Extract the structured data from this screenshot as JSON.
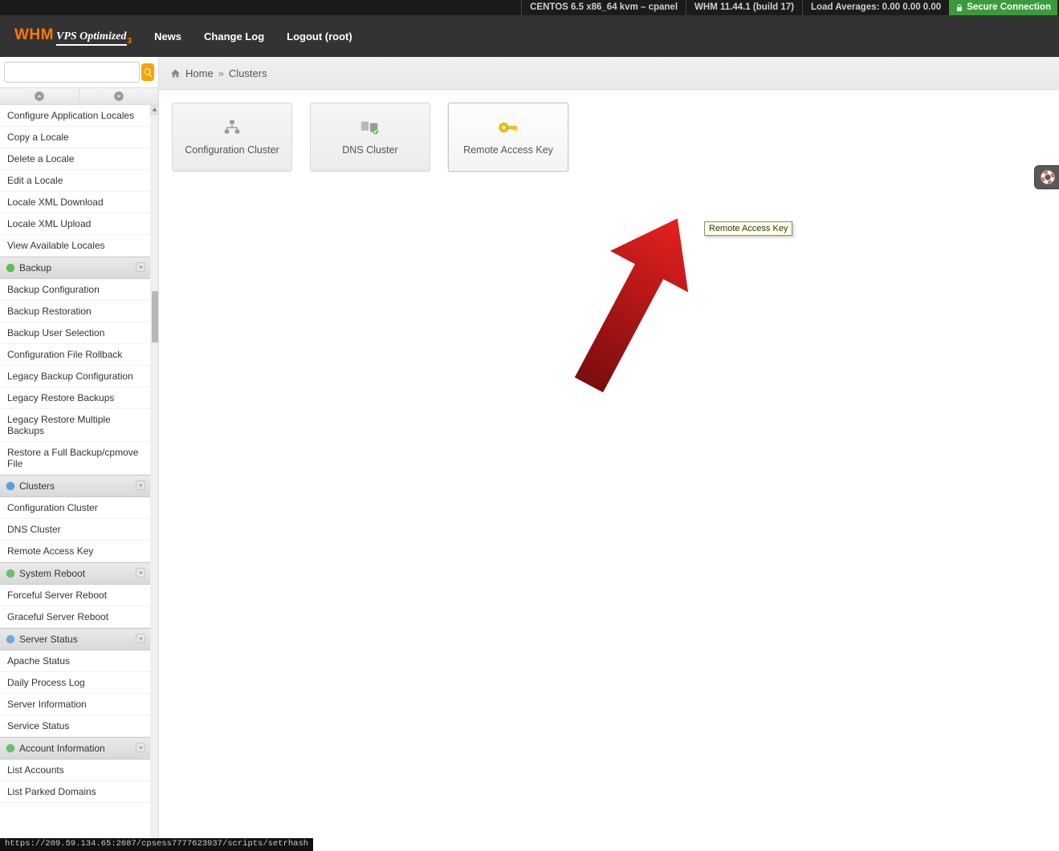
{
  "topbar": {
    "os": "CENTOS 6.5 x86_64 kvm – cpanel",
    "whm": "WHM 11.44.1 (build 17)",
    "load": "Load Averages: 0.00 0.00 0.00",
    "secure": "Secure Connection"
  },
  "header": {
    "logo_whm": "WHM",
    "logo_vps": "VPS Optimized",
    "logo_suffix": "3",
    "menu": [
      "News",
      "Change Log",
      "Logout (root)"
    ]
  },
  "search": {
    "value": ""
  },
  "breadcrumb": {
    "home": "Home",
    "sep": "»",
    "current": "Clusters"
  },
  "sidebar": {
    "pre_items": [
      "Configure Application Locales",
      "Copy a Locale",
      "Delete a Locale",
      "Edit a Locale",
      "Locale XML Download",
      "Locale XML Upload",
      "View Available Locales"
    ],
    "sections": [
      {
        "title": "Backup",
        "icon": "backup",
        "items": [
          "Backup Configuration",
          "Backup Restoration",
          "Backup User Selection",
          "Configuration File Rollback",
          "Legacy Backup Configuration",
          "Legacy Restore Backups",
          "Legacy Restore Multiple Backups",
          "Restore a Full Backup/cpmove File"
        ]
      },
      {
        "title": "Clusters",
        "icon": "clusters",
        "items": [
          "Configuration Cluster",
          "DNS Cluster",
          "Remote Access Key"
        ]
      },
      {
        "title": "System Reboot",
        "icon": "reboot",
        "items": [
          "Forceful Server Reboot",
          "Graceful Server Reboot"
        ]
      },
      {
        "title": "Server Status",
        "icon": "status",
        "items": [
          "Apache Status",
          "Daily Process Log",
          "Server Information",
          "Service Status"
        ]
      },
      {
        "title": "Account Information",
        "icon": "account",
        "items": [
          "List Accounts",
          "List Parked Domains"
        ]
      }
    ]
  },
  "tiles": [
    {
      "label": "Configuration Cluster",
      "icon": "config-cluster"
    },
    {
      "label": "DNS Cluster",
      "icon": "dns-cluster"
    },
    {
      "label": "Remote Access Key",
      "icon": "key"
    }
  ],
  "tooltip": "Remote Access Key",
  "statusbar": "https://209.59.134.65:2087/cpsess7777623937/scripts/setrhash"
}
